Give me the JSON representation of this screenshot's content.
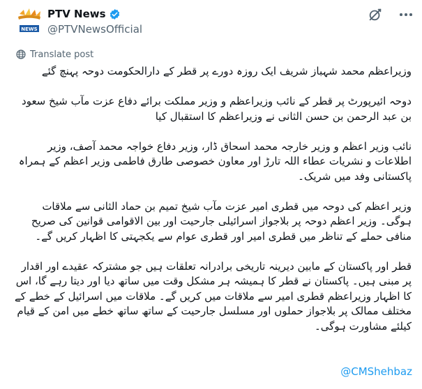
{
  "account": {
    "display_name": "PTV News",
    "handle": "@PTVNewsOfficial",
    "verified": true,
    "avatar_icon": "ptv-news-logo-icon"
  },
  "actions": {
    "grok_icon": "grok-icon",
    "more_icon": "more-horizontal-icon"
  },
  "translate_label": "Translate post",
  "post": {
    "paragraphs": [
      "وزیراعظم محمد شہباز شریف ایک روزہ دورے پر قطر کے دارالحکومت دوحہ پہنچ گئے",
      "دوحہ ائیرپورٹ پر قطر کے نائب وزیراعظم و وزیر مملکت برائے دفاع عزت مآب شیخ سعود بن عبد الرحمن بن حسن الثانی نے وزیراعظم کا استقبال کیا",
      "نائب وزیر اعظم و وزیر خارجہ محمد اسحاق ڈار، وزیر دفاع خواجہ محمد آصف، وزیر اطلاعات و نشریات عطاء اللہ تارڑ اور معاون خصوصی طارق فاطمی وزیر اعظم کے ہمراہ پاکستانی وفد میں شریک۔",
      "وزیر اعظم کی دوحہ میں قطری امیر عزت مآب شیخ تمیم بن حماد الثانی سے ملاقات ہوگی۔ وزیر اعظم دوحہ پر بلاجواز اسرائیلی جارحیت اور بین الاقوامی قوانین کی صریح منافی حملے کے تناظر میں قطری امیر اور قطری عوام سے یکجہتی کا اظہار کریں گے۔",
      "قطر اور پاکستان کے مابین دیرینہ تاریخی برادرانہ تعلقات ہیں جو مشترکہ عقیدے اور اقدار پر مبنی ہیں۔ پاکستان نے قطر کا ہمیشہ ہر مشکل وقت میں ساتھ دیا اور دیتا رہے گا، اس کا اظہار وزیراعظم قطری امیر سے ملاقات میں کریں گے۔ ملاقات میں اسرائیل کے خطے کے مختلف ممالک پر بلاجواز حملوں اور مسلسل جارحیت کے ساتھ ساتھ خطے میں امن کے قیام کیلئے مشاورت ہوگی۔"
    ],
    "mention": "@CMShehbaz"
  },
  "colors": {
    "link": "#1d9bf0",
    "verified": "#1d9bf0",
    "secondary_text": "#536471",
    "primary_text": "#0f1419"
  }
}
